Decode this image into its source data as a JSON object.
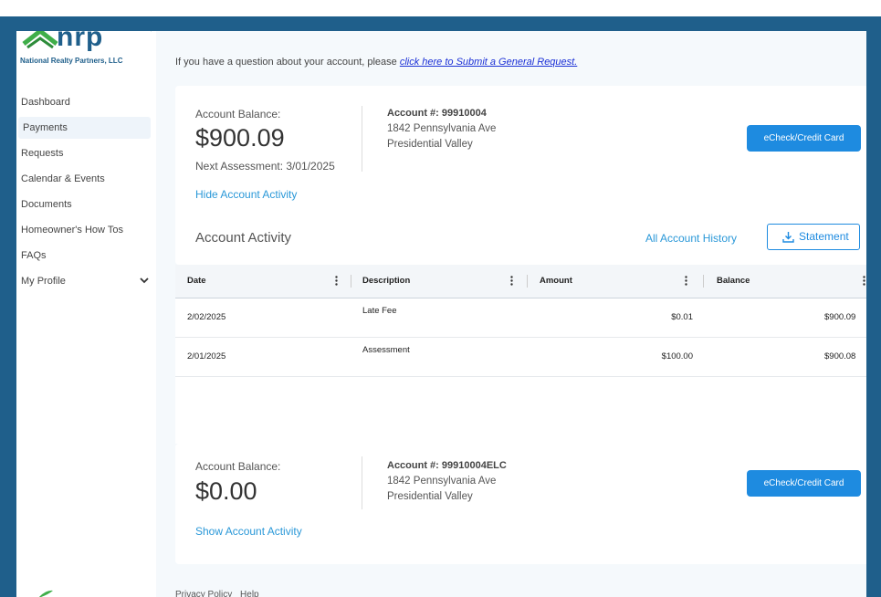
{
  "brand": {
    "logo_text": "nrp",
    "company_name": "National Realty Partners, LLC",
    "logo_colors": {
      "green": "#3fae49",
      "blue": "#1f5f8b"
    }
  },
  "sidebar": {
    "items": [
      {
        "label": "Dashboard"
      },
      {
        "label": "Payments",
        "active": true
      },
      {
        "label": "Requests"
      },
      {
        "label": "Calendar & Events"
      },
      {
        "label": "Documents"
      },
      {
        "label": "Homeowner's How Tos"
      },
      {
        "label": "FAQs"
      },
      {
        "label": "My Profile",
        "icon": "chevron-down-icon"
      }
    ]
  },
  "notice": {
    "text": "If you have a question about your account, please ",
    "link": "click here to Submit a General Request."
  },
  "accounts": [
    {
      "balance_label": "Account Balance:",
      "balance": "$900.09",
      "next_assessment": "Next Assessment: 3/01/2025",
      "toggle_link": "Hide Account Activity",
      "account_number": "Account #: 99910004",
      "address_line1": "1842 Pennsylvania Ave",
      "address_line2": "Presidential Valley",
      "pay_button": "eCheck/Credit Card"
    },
    {
      "balance_label": "Account Balance:",
      "balance": "$0.00",
      "toggle_link": "Show Account Activity",
      "account_number": "Account #: 99910004ELC",
      "address_line1": "1842 Pennsylvania Ave",
      "address_line2": "Presidential Valley",
      "pay_button": "eCheck/Credit Card"
    }
  ],
  "activity": {
    "title": "Account Activity",
    "history_link": "All Account History",
    "statement_button": "Statement",
    "columns": [
      "Date",
      "Description",
      "Amount",
      "Balance"
    ],
    "rows": [
      {
        "date": "2/02/2025",
        "description": "Late Fee",
        "amount": "$0.01",
        "balance": "$900.09"
      },
      {
        "date": "2/01/2025",
        "description": "Assessment",
        "amount": "$100.00",
        "balance": "$900.08"
      }
    ]
  },
  "colors": {
    "frame_bg": "#1f5f8b",
    "accent": "#1e8be0",
    "link": "#2a98d8",
    "notice_link": "#1a2fd6"
  },
  "footer": {
    "privacy": "Privacy Policy",
    "help": "Help"
  }
}
